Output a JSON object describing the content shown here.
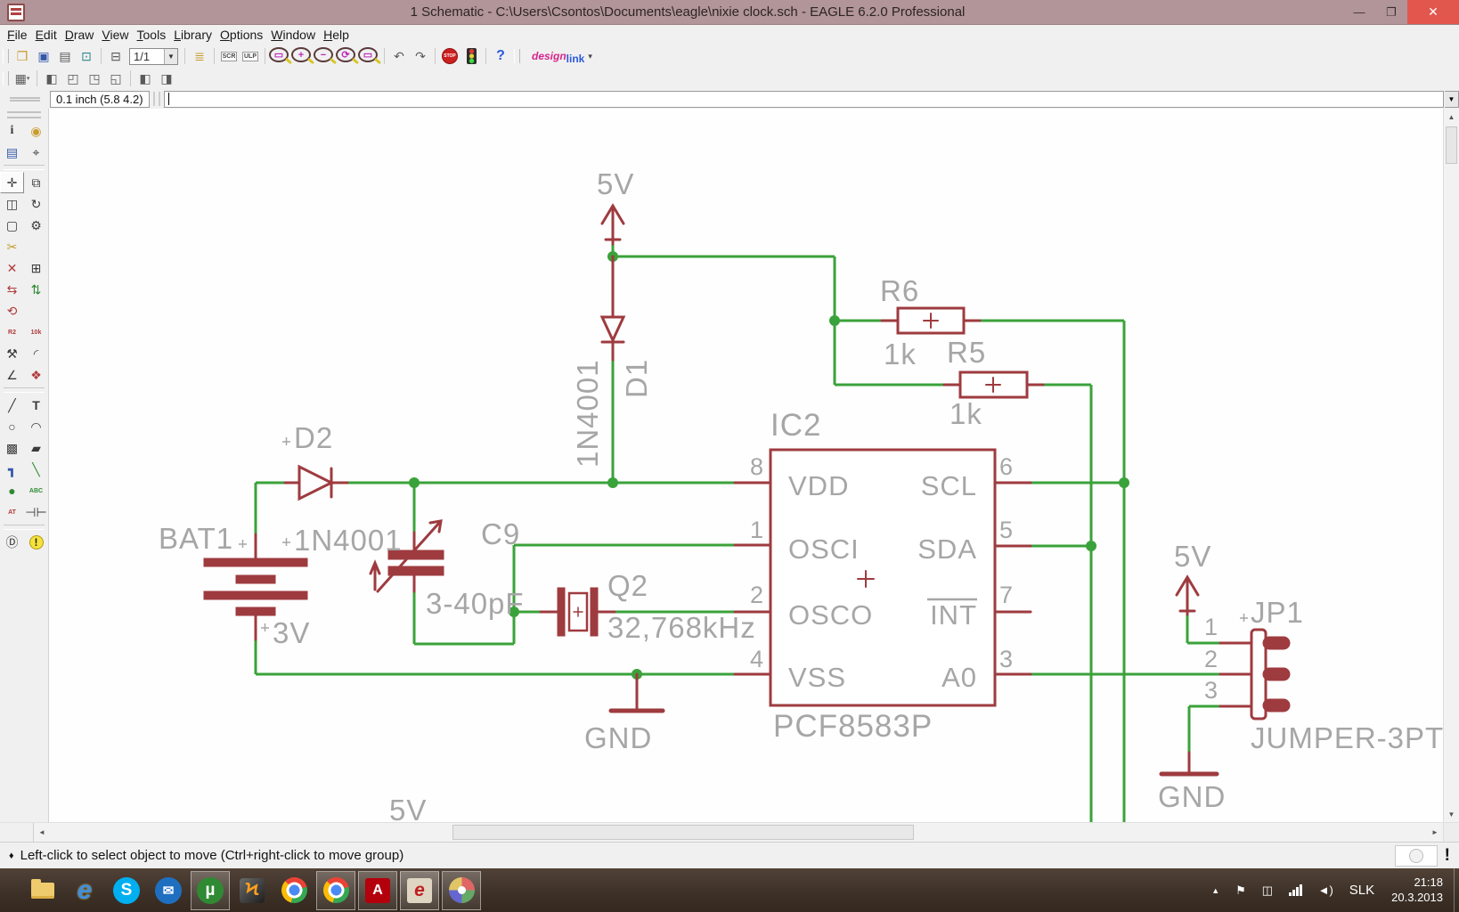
{
  "window": {
    "title": "1 Schematic - C:\\Users\\Csontos\\Documents\\eagle\\nixie clock.sch - EAGLE 6.2.0 Professional",
    "minimize_glyph": "—",
    "restore_glyph": "❐",
    "close_glyph": "✕"
  },
  "menu": {
    "items": [
      "File",
      "Edit",
      "Draw",
      "View",
      "Tools",
      "Library",
      "Options",
      "Window",
      "Help"
    ]
  },
  "toolbar": {
    "sheet": "1/1",
    "sheet_caret": "▼",
    "items": [
      {
        "name": "open",
        "glyph": "❒"
      },
      {
        "name": "save",
        "glyph": "▣"
      },
      {
        "name": "print",
        "glyph": "▤"
      },
      {
        "name": "cam",
        "glyph": "⊡"
      },
      {
        "name": "board",
        "glyph": "⊟"
      },
      {
        "name": "library",
        "glyph": "≣"
      },
      {
        "name": "script",
        "glyph": "SCR"
      },
      {
        "name": "ulp",
        "glyph": "ULP"
      },
      {
        "name": "zoom-fit",
        "glyph": "▭"
      },
      {
        "name": "zoom-in",
        "glyph": "+"
      },
      {
        "name": "zoom-out",
        "glyph": "−"
      },
      {
        "name": "zoom-redraw",
        "glyph": "⟳"
      },
      {
        "name": "zoom-select",
        "glyph": "▭"
      },
      {
        "name": "undo",
        "glyph": "↶"
      },
      {
        "name": "redo",
        "glyph": "↷"
      },
      {
        "name": "stop",
        "glyph": "STOP"
      },
      {
        "name": "run",
        "glyph": ""
      },
      {
        "name": "help",
        "glyph": "?"
      }
    ],
    "designlink": {
      "part1": "design",
      "part2": "link",
      "caret": "▾"
    }
  },
  "toolbar2": {
    "items": [
      {
        "name": "grid",
        "glyph": "▦"
      },
      {
        "name": "split-layout-1",
        "glyph": "◧"
      },
      {
        "name": "split-layout-2",
        "glyph": "◰"
      },
      {
        "name": "split-layout-3",
        "glyph": "◳"
      },
      {
        "name": "split-layout-4",
        "glyph": "◱"
      },
      {
        "name": "frame-layout-1",
        "glyph": "◧"
      },
      {
        "name": "frame-layout-2",
        "glyph": "◨"
      }
    ],
    "grid_caret": "▾"
  },
  "coordbar": {
    "position": "0.1 inch (5.8 4.2)",
    "command": ""
  },
  "sidebar": {
    "tools": [
      {
        "name": "info",
        "glyph": "i"
      },
      {
        "name": "show",
        "glyph": "◉"
      },
      {
        "name": "display",
        "glyph": "▤"
      },
      {
        "name": "mark",
        "glyph": "⌖"
      },
      {
        "name": "move",
        "glyph": "✛"
      },
      {
        "name": "copy",
        "glyph": "⧉"
      },
      {
        "name": "mirror",
        "glyph": "◫"
      },
      {
        "name": "rotate",
        "glyph": "↻"
      },
      {
        "name": "group",
        "glyph": "▢"
      },
      {
        "name": "change",
        "glyph": "⚙"
      },
      {
        "name": "cut",
        "glyph": "✂"
      },
      {
        "name": "",
        "glyph": ""
      },
      {
        "name": "delete",
        "glyph": "✕"
      },
      {
        "name": "add",
        "glyph": "⊞"
      },
      {
        "name": "pinswap",
        "glyph": "⇆"
      },
      {
        "name": "gateswap",
        "glyph": "⇅"
      },
      {
        "name": "replace",
        "glyph": "⟲"
      },
      {
        "name": "",
        "glyph": ""
      },
      {
        "name": "name",
        "glyph": "R2"
      },
      {
        "name": "value",
        "glyph": "10k"
      },
      {
        "name": "smash",
        "glyph": "⚒"
      },
      {
        "name": "miter",
        "glyph": "◜"
      },
      {
        "name": "split",
        "glyph": "∠"
      },
      {
        "name": "invoke",
        "glyph": "❖"
      },
      {
        "name": "wire",
        "glyph": "╱"
      },
      {
        "name": "text",
        "glyph": "T"
      },
      {
        "name": "circle",
        "glyph": "○"
      },
      {
        "name": "arc",
        "glyph": "◠"
      },
      {
        "name": "rect",
        "glyph": "▩"
      },
      {
        "name": "polygon",
        "glyph": "▰"
      },
      {
        "name": "bus",
        "glyph": "┓"
      },
      {
        "name": "net",
        "glyph": "╲"
      },
      {
        "name": "junction",
        "glyph": "●"
      },
      {
        "name": "label",
        "glyph": "ABC"
      },
      {
        "name": "attribute",
        "glyph": "AT"
      },
      {
        "name": "dimension",
        "glyph": "⊣⊢"
      },
      {
        "name": "erc",
        "glyph": "Ⓓ"
      },
      {
        "name": "errors",
        "glyph": "!"
      }
    ]
  },
  "schematic": {
    "power_5v_top": "5V",
    "power_5v_jp1": "5V",
    "power_5v_bottom": "5V",
    "gnd_ic": "GND",
    "gnd_jp1": "GND",
    "d1": {
      "name": "D1",
      "value": "1N4001"
    },
    "d2": {
      "name": "D2",
      "value": "1N4001"
    },
    "bat1": {
      "name": "BAT1",
      "value": "3V"
    },
    "c9": {
      "name": "C9",
      "value": "3-40pF"
    },
    "q2": {
      "name": "Q2",
      "value": "32,768kHz"
    },
    "r6": {
      "name": "R6",
      "value": "1k"
    },
    "r5": {
      "name": "R5",
      "value": "1k"
    },
    "ic2": {
      "name": "IC2",
      "value": "PCF8583P",
      "pins_left": [
        {
          "num": "8",
          "name": "VDD"
        },
        {
          "num": "1",
          "name": "OSCI"
        },
        {
          "num": "2",
          "name": "OSCO"
        },
        {
          "num": "4",
          "name": "VSS"
        }
      ],
      "pins_right": [
        {
          "num": "6",
          "name": "SCL"
        },
        {
          "num": "5",
          "name": "SDA"
        },
        {
          "num": "7",
          "name": "INT"
        },
        {
          "num": "3",
          "name": "A0"
        }
      ]
    },
    "jp1": {
      "name": "JP1",
      "value": "JUMPER-3PT",
      "pins": [
        "1",
        "2",
        "3"
      ]
    },
    "colors": {
      "wire": "#3aa23a",
      "symbol": "#9e3b3f",
      "label": "#a6a6a6"
    }
  },
  "statusbar": {
    "bullet": "♦",
    "message": "Left-click to select object to move (Ctrl+right-click to move group)",
    "alert": "!"
  },
  "taskbar": {
    "apps": [
      {
        "name": "file-explorer",
        "glyph": ""
      },
      {
        "name": "internet-explorer",
        "glyph": "e"
      },
      {
        "name": "skype",
        "glyph": "S"
      },
      {
        "name": "thunderbird",
        "glyph": "✉"
      },
      {
        "name": "utorrent",
        "glyph": "µ"
      },
      {
        "name": "winamp",
        "glyph": "Ϟ"
      },
      {
        "name": "chrome",
        "glyph": ""
      },
      {
        "name": "chrome-2",
        "glyph": ""
      },
      {
        "name": "adobe-reader",
        "glyph": "A"
      },
      {
        "name": "eagle",
        "glyph": "e"
      },
      {
        "name": "paint",
        "glyph": ""
      }
    ],
    "tray": {
      "hidden_icons": "▲",
      "flag": "⚑",
      "mixer": "◫",
      "speaker": "◄)",
      "lang": "SLK",
      "time": "21:18",
      "date": "20.3.2013"
    }
  }
}
